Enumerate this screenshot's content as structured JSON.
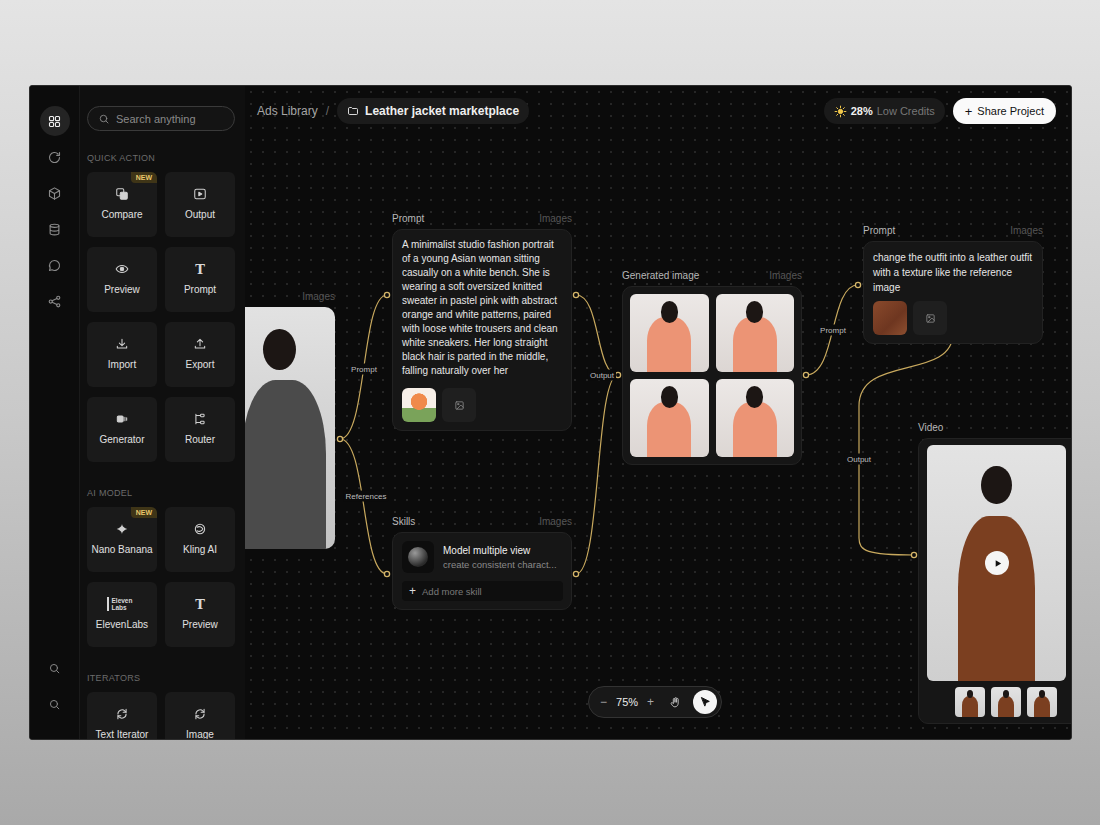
{
  "breadcrumb": {
    "root": "Ads Library",
    "separator": "/",
    "project": "Leather jacket marketplace"
  },
  "credits": {
    "percent": "28%",
    "label": "Low Credits"
  },
  "share_button": {
    "icon": "+",
    "label": "Share Project"
  },
  "rail": {
    "top": [
      {
        "kind": "grid",
        "selected": true
      },
      {
        "kind": "refresh",
        "selected": false
      },
      {
        "kind": "cube",
        "selected": false
      },
      {
        "kind": "database",
        "selected": false
      },
      {
        "kind": "chat",
        "selected": false
      },
      {
        "kind": "share",
        "selected": false
      }
    ],
    "bottom": [
      {
        "kind": "search",
        "selected": false
      },
      {
        "kind": "search",
        "selected": false
      }
    ]
  },
  "search": {
    "placeholder": "Search anything"
  },
  "sections": [
    {
      "title": "QUICK ACTION",
      "items": [
        {
          "label": "Compare",
          "kind": "compare",
          "badge": "NEW"
        },
        {
          "label": "Output",
          "kind": "output"
        },
        {
          "label": "Preview",
          "kind": "preview"
        },
        {
          "label": "Prompt",
          "kind": "glyph",
          "glyph": "T"
        },
        {
          "label": "Import",
          "kind": "import"
        },
        {
          "label": "Export",
          "kind": "export"
        },
        {
          "label": "Generator",
          "kind": "generator"
        },
        {
          "label": "Router",
          "kind": "router"
        }
      ]
    },
    {
      "title": "AI MODEL",
      "items": [
        {
          "label": "Nano Banana",
          "kind": "sparkle",
          "badge": "NEW"
        },
        {
          "label": "Kling AI",
          "kind": "kling"
        },
        {
          "label": "ElevenLabs",
          "kind": "logo",
          "glyph": "Eleven Labs"
        },
        {
          "label": "Preview",
          "kind": "glyph",
          "glyph": "T"
        }
      ]
    },
    {
      "title": "ITERATORS",
      "items": [
        {
          "label": "Text Iterator",
          "kind": "iterator"
        },
        {
          "label": "Image",
          "kind": "iterator"
        }
      ]
    }
  ],
  "source_node": {
    "tag": "Images"
  },
  "prompt_node": {
    "title": "Prompt",
    "tag": "Images",
    "text": "A minimalist studio fashion portrait of a young Asian woman sitting casually on a white bench. She is wearing a soft oversized knitted sweater in pastel pink with abstract orange and white patterns, paired with loose white trousers and clean white sneakers. Her long straight black hair is parted in the middle, falling naturally over her"
  },
  "skills_node": {
    "title": "Skills",
    "tag": "Images",
    "items": [
      {
        "name": "Model multiple view",
        "description": "create consistent charact..."
      }
    ],
    "add_icon": "+",
    "add_label": "Add more skill"
  },
  "generated_node": {
    "title": "Generated image",
    "tag": "Images",
    "image_count": 4
  },
  "edit_node": {
    "title": "Prompt",
    "tag": "Images",
    "text": "change the outfit into a leather outfit with a texture like the reference image"
  },
  "video_node": {
    "title": "Video",
    "thumbnail_count": 3
  },
  "connectors": [
    {
      "label": "Prompt"
    },
    {
      "label": "References"
    },
    {
      "label": "Output"
    },
    {
      "label": "Prompt"
    },
    {
      "label": "Output"
    }
  ],
  "zoom": {
    "minus": "−",
    "level": "75%",
    "plus": "+",
    "tools": [
      {
        "kind": "hand",
        "selected": false
      },
      {
        "kind": "pointer",
        "selected": true
      }
    ]
  }
}
